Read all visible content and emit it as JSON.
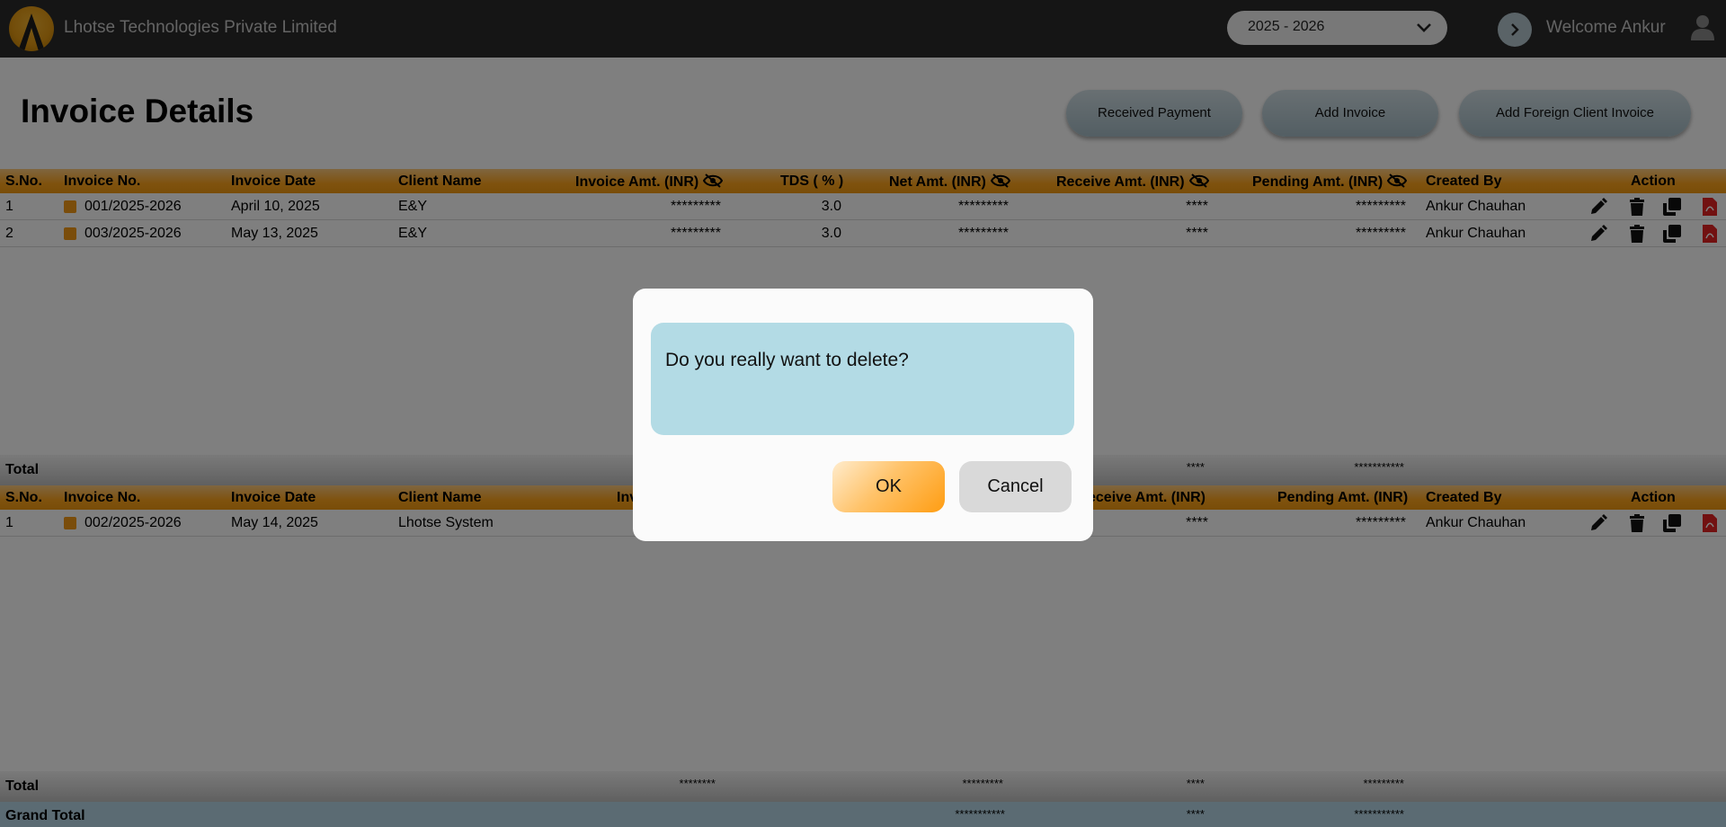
{
  "header": {
    "company": "Lhotse Technologies Private Limited",
    "year_selected": "2025 - 2026",
    "welcome": "Welcome Ankur"
  },
  "page": {
    "title": "Invoice Details",
    "buttons": [
      "Received Payment",
      "Add Invoice",
      "Add Foreign Client Invoice"
    ]
  },
  "domestic": {
    "headers": {
      "sno": "S.No.",
      "invoice_no": "Invoice No.",
      "invoice_date": "Invoice Date",
      "client": "Client Name",
      "invoice_amt": "Invoice Amt. (INR)",
      "tds": "TDS ( % )",
      "net_amt": "Net Amt. (INR)",
      "receive_amt": "Receive Amt. (INR)",
      "pending_amt": "Pending Amt. (INR)",
      "created_by": "Created By",
      "action": "Action"
    },
    "rows": [
      {
        "sno": "1",
        "invoice_no": "001/2025-2026",
        "date": "April 10, 2025",
        "client": "E&Y",
        "invoice_amt": "*********",
        "tds": "3.0",
        "net_amt": "*********",
        "receive_amt": "****",
        "pending_amt": "*********",
        "created_by": "Ankur Chauhan"
      },
      {
        "sno": "2",
        "invoice_no": "003/2025-2026",
        "date": "May 13, 2025",
        "client": "E&Y",
        "invoice_amt": "*********",
        "tds": "3.0",
        "net_amt": "*********",
        "receive_amt": "****",
        "pending_amt": "*********",
        "created_by": "Ankur Chauhan"
      }
    ],
    "total": {
      "label": "Total",
      "receive": "****",
      "pending": "***********"
    }
  },
  "foreign": {
    "headers": {
      "sno": "S.No.",
      "invoice_no": "Invoice No.",
      "invoice_date": "Invoice Date",
      "client": "Client Name",
      "invoice_amt_partial": "Inv",
      "receive_amt_partial": "eceive Amt. (INR)",
      "pending_amt": "Pending Amt. (INR)",
      "created_by": "Created By",
      "action": "Action"
    },
    "rows": [
      {
        "sno": "1",
        "invoice_no": "002/2025-2026",
        "date": "May 14, 2025",
        "client": "Lhotse System",
        "receive_amt": "****",
        "pending_amt": "*********",
        "created_by": "Ankur Chauhan"
      }
    ],
    "total": {
      "label": "Total",
      "invoice": "********",
      "net": "*********",
      "receive": "****",
      "pending": "*********"
    }
  },
  "grand_total": {
    "label": "Grand Total",
    "net": "***********",
    "receive": "****",
    "pending": "***********"
  },
  "dialog": {
    "message": "Do you really want to delete?",
    "ok": "OK",
    "cancel": "Cancel"
  },
  "colors": {
    "header_bg": "#2b2b2b",
    "table_header": "#ffa51d",
    "dialog_message_bg": "#b3dbe5",
    "pdf_icon": "#e52222"
  }
}
